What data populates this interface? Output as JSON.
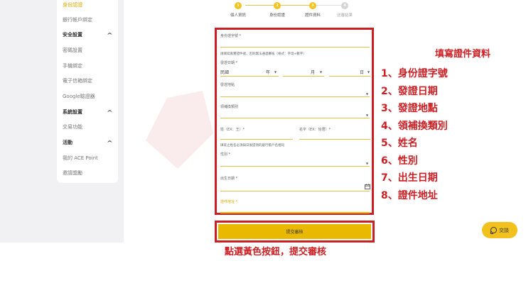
{
  "sidebar": {
    "items": [
      {
        "label": "身份認證",
        "type": "item",
        "active": true
      },
      {
        "label": "銀行帳戶綁定",
        "type": "item"
      },
      {
        "label": "安全設置",
        "type": "header"
      },
      {
        "label": "密碼設置",
        "type": "item"
      },
      {
        "label": "手機綁定",
        "type": "item"
      },
      {
        "label": "電子信箱綁定",
        "type": "item"
      },
      {
        "label": "Google驗證器",
        "type": "item"
      },
      {
        "label": "系統設置",
        "type": "header"
      },
      {
        "label": "交易功能",
        "type": "item"
      },
      {
        "label": "活動",
        "type": "header"
      },
      {
        "label": "我的 ACE Point",
        "type": "item"
      },
      {
        "label": "邀請獎勵",
        "type": "item"
      }
    ]
  },
  "stepper": {
    "steps": [
      {
        "num": "1",
        "label": "個人資訊",
        "done": true
      },
      {
        "num": "2",
        "label": "身份認證",
        "done": true
      },
      {
        "num": "3",
        "label": "證件資料",
        "done": true
      },
      {
        "num": "4",
        "label": "送審結果",
        "done": false
      }
    ]
  },
  "form": {
    "id_number_label": "身份證字號 *",
    "id_hint": "請填寫真實證件號，否則無法通過審核（格式：字母+數字）",
    "issue_date_label": "發證日期 *",
    "era_value": "民國",
    "year_unit": "年",
    "month_unit": "月",
    "day_unit": "日",
    "issue_place_label": "發證地點",
    "reissue_type_label": "領補換類別",
    "last_name_label": "姓（EX：王）*",
    "first_name_label": "名字（EX：怡君）*",
    "name_hint": "填寫之姓名必須與日後提領的銀行帳戶名相同",
    "gender_label": "性別 *",
    "birthdate_label": "出生日期 *",
    "address_label": "證件地址 *",
    "submit_label": "提交審核"
  },
  "annotations": {
    "title": "填寫證件資料",
    "items": [
      "1、身份證字號",
      "2、發證日期",
      "3、發證地點",
      "4、領補換類別",
      "5、姓名",
      "6、性別",
      "7、出生日期",
      "8、證件地址"
    ],
    "bottom": "點選黃色按鈕，提交審核"
  },
  "chat": {
    "label": "交談"
  },
  "colors": {
    "accent": "#f3c31d",
    "annotation": "#cc1f24",
    "background": "#f1f1f3"
  },
  "icons": {
    "calendar": "calendar-icon",
    "chat": "chat-bubble-icon",
    "dropdown": "caret-down-icon"
  }
}
